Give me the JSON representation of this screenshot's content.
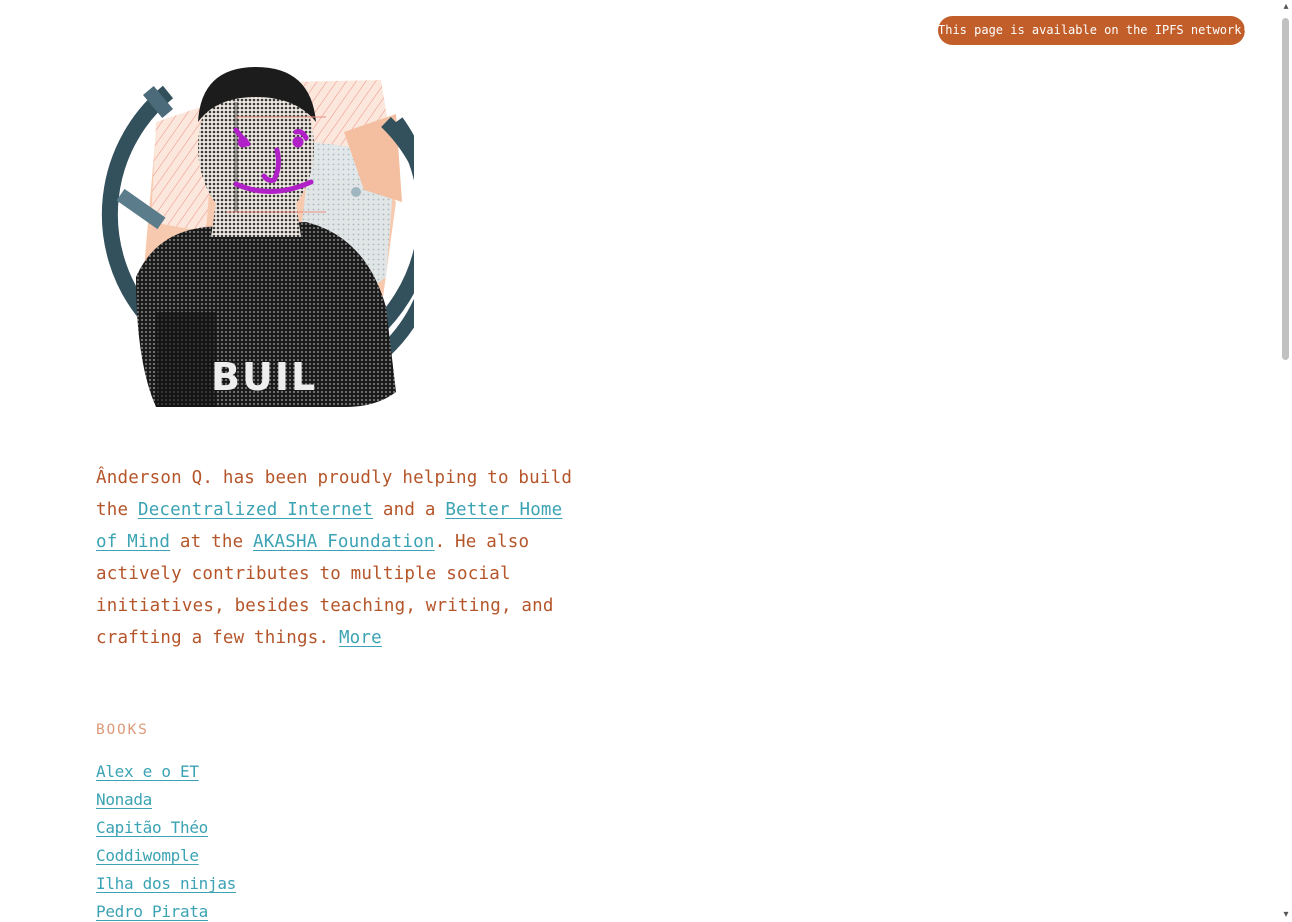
{
  "ipfs_badge": {
    "label": "This page is available on the IPFS network!",
    "color": "#c25e2a"
  },
  "avatar": {
    "alt": "Ânderson Q.",
    "shirt_text": "BUIL"
  },
  "bio": {
    "text_1": "Ânderson Q. has been proudly helping to build the ",
    "link_decentralized": "Decentralized Internet",
    "text_2": " and a ",
    "link_better_home": "Better Home of Mind",
    "text_3": " at the ",
    "link_akasha": "AKASHA Foundation",
    "text_4": ". He also actively contributes to multiple social initiatives, besides teaching, writing, and crafting a few things. ",
    "link_more": "More"
  },
  "books": {
    "heading": "BOOKS",
    "items": [
      "Alex e o ET",
      "Nonada",
      "Capitão Théo",
      "Coddiwomple",
      "Ilha dos ninjas",
      "Pedro Pirata"
    ]
  },
  "colors": {
    "text": "#b5552a",
    "link": "#3ba3b3",
    "heading": "#dc9a78"
  }
}
